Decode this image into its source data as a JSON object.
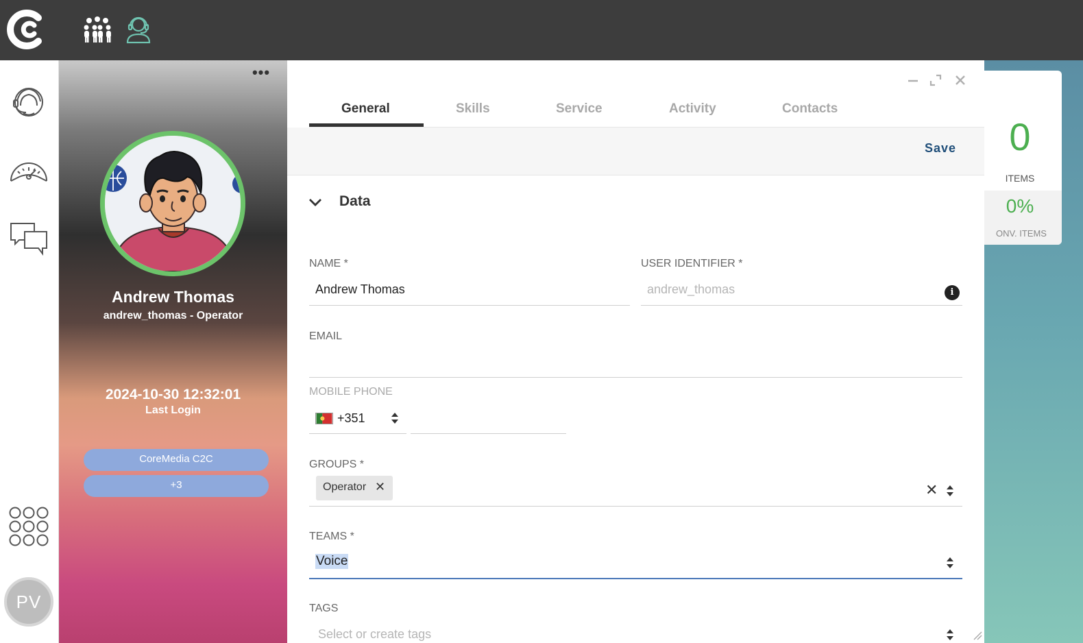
{
  "topbar": {
    "logo_icon": "c-logo-icon",
    "icons": [
      "team-icon",
      "operator-headset-icon"
    ],
    "accent_color": "#6fc3b0"
  },
  "sidebar": {
    "icons": [
      "agent-headset-icon",
      "dashboard-gauge-icon",
      "chat-bubbles-icon",
      "apps-grid-icon"
    ],
    "user_initials": "PV"
  },
  "stats": {
    "count": "0",
    "count_label": "ITEMS",
    "percent": "0%",
    "percent_label": "ONV. ITEMS"
  },
  "profile": {
    "name": "Andrew Thomas",
    "subtitle": "andrew_thomas - Operator",
    "last_login_date": "2024-10-30 12:32:01",
    "last_login_label": "Last Login",
    "pills": [
      "CoreMedia C2C",
      "+3"
    ],
    "status_color": "#6cc36a"
  },
  "tabs": [
    "General",
    "Skills",
    "Service",
    "Activity",
    "Contacts"
  ],
  "active_tab": "General",
  "toolbar": {
    "save_label": "Save"
  },
  "section": {
    "title": "Data"
  },
  "form": {
    "name_label": "NAME *",
    "name_value": "Andrew Thomas",
    "user_id_label": "USER IDENTIFIER *",
    "user_id_value": "andrew_thomas",
    "email_label": "EMAIL",
    "email_value": "",
    "mobile_label": "MOBILE PHONE",
    "mobile_code": "+351",
    "mobile_number": "",
    "groups_label": "GROUPS *",
    "groups": [
      "Operator"
    ],
    "teams_label": "TEAMS *",
    "teams_value": "Voice",
    "tags_label": "TAGS",
    "tags_placeholder": "Select or create tags"
  }
}
